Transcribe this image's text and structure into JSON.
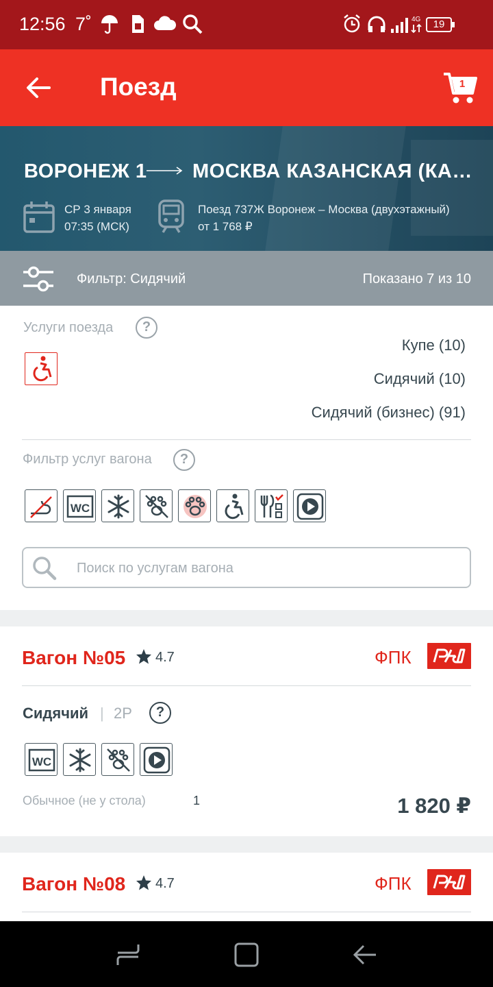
{
  "status_bar": {
    "time": "12:56",
    "temperature": "7˚",
    "battery": "19",
    "network": "4G"
  },
  "app_bar": {
    "title": "Поезд",
    "cart_count": "1"
  },
  "route": {
    "from": "ВОРОНЕЖ 1",
    "to": "МОСКВА КАЗАНСКАЯ (КАЗАНСКИЙ ВОКЗАЛ)",
    "date": "СР 3 января",
    "time": "07:35 (МСК)",
    "train": "Поезд 737Ж Воронеж – Москва (двухэтажный)",
    "price_from": "от 1 768 ₽"
  },
  "filter_bar": {
    "label": "Фильтр: Сидячий",
    "shown": "Показано 7 из 10"
  },
  "train_services": {
    "label": "Услуги поезда",
    "help": "?"
  },
  "car_types": [
    {
      "label": "Купе (10)"
    },
    {
      "label": "Сидячий (10)"
    },
    {
      "label": "Сидячий (бизнес) (91)"
    }
  ],
  "car_service_filter": {
    "label": "Фильтр услуг вагона",
    "help": "?",
    "icons": [
      "no-smoking-icon",
      "wc-icon",
      "air-conditioning-icon",
      "no-pets-icon",
      "pets-allowed-icon",
      "wheelchair-icon",
      "food-icon",
      "media-icon"
    ]
  },
  "search": {
    "placeholder": "Поиск по услугам вагона"
  },
  "wagons": [
    {
      "title": "Вагон №05",
      "rating": "4.7",
      "carrier": "ФПК",
      "class": "Сидячий",
      "class_code": "2Р",
      "help": "?",
      "seat_type": "Обычное (не у стола)",
      "seat_count": "1",
      "price": "1 820 ₽"
    },
    {
      "title": "Вагон №08",
      "rating": "4.7",
      "carrier": "ФПК"
    }
  ],
  "colors": {
    "brand_red": "#ee3124",
    "status_red": "#a3171b",
    "banner": "#2a5a6e",
    "filter_grey": "#8f9aa1"
  }
}
